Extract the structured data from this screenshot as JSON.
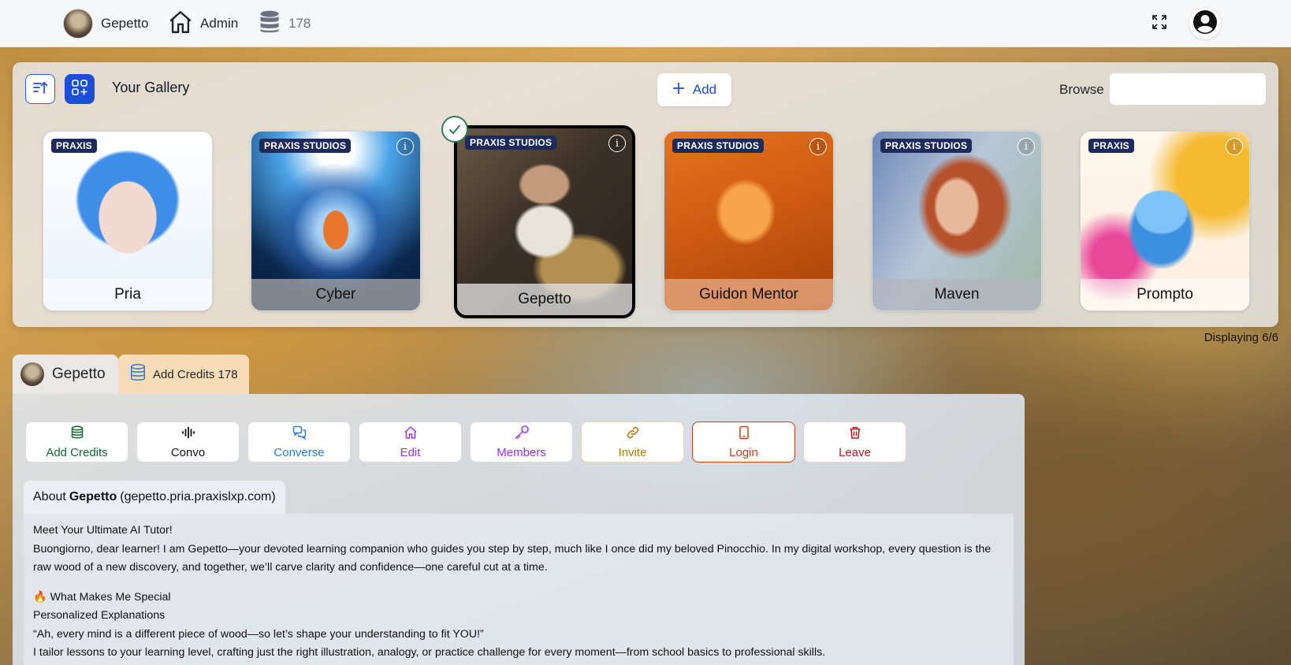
{
  "topbar": {
    "user_name": "Gepetto",
    "admin_label": "Admin",
    "credits": "178",
    "icons": [
      "avatar",
      "home-icon",
      "database-icon",
      "fullscreen-icon",
      "user-circle-icon"
    ]
  },
  "gallery": {
    "title": "Your Gallery",
    "add_label": "Add",
    "browse_label": "Browse",
    "browse_value": "",
    "displaying": "Displaying 6/6",
    "cards": [
      {
        "name": "Pria",
        "badge": "PRAXIS",
        "info": "i"
      },
      {
        "name": "Cyber",
        "badge": "PRAXIS STUDIOS",
        "info": "i"
      },
      {
        "name": "Gepetto",
        "badge": "PRAXIS STUDIOS",
        "info": "i",
        "selected": true
      },
      {
        "name": "Guidon Mentor",
        "badge": "PRAXIS STUDIOS",
        "info": "i"
      },
      {
        "name": "Maven",
        "badge": "PRAXIS STUDIOS",
        "info": "i"
      },
      {
        "name": "Prompto",
        "badge": "PRAXIS",
        "info": "i"
      }
    ]
  },
  "tabs": {
    "user_name": "Gepetto",
    "add_credits": "Add Credits 178"
  },
  "actions": [
    {
      "label": "Add Credits",
      "icon": "database-icon",
      "color": "#166534"
    },
    {
      "label": "Convo",
      "icon": "waveform-icon",
      "color": "#111111"
    },
    {
      "label": "Converse",
      "icon": "chat-icon",
      "color": "#2b7bd6"
    },
    {
      "label": "Edit",
      "icon": "home-icon",
      "color": "#9333ea"
    },
    {
      "label": "Members",
      "icon": "key-icon",
      "color": "#9333ea"
    },
    {
      "label": "Invite",
      "icon": "link-icon",
      "color": "#b9770e"
    },
    {
      "label": "Login",
      "icon": "tablet-icon",
      "color": "#c2410c"
    },
    {
      "label": "Leave",
      "icon": "trash-icon",
      "color": "#b91c1c"
    }
  ],
  "about": {
    "prefix": "About",
    "name": "Gepetto",
    "domain": "(gepetto.pria.praxislxp.com)",
    "lines": [
      "Meet Your Ultimate AI Tutor!",
      "Buongiorno, dear learner! I am Gepetto—your devoted learning companion who guides you step by step, much like I once did my beloved Pinocchio. In my digital workshop, every question is the raw wood of a new discovery, and together, we’ll carve clarity and confidence—one careful cut at a time.",
      "🔥 What Makes Me Special",
      "Personalized Explanations",
      "“Ah, every mind is a different piece of wood—so let’s shape your understanding to fit YOU!”",
      "I tailor lessons to your learning level, crafting just the right illustration, analogy, or practice challenge for every moment—from school basics to professional skills."
    ]
  }
}
